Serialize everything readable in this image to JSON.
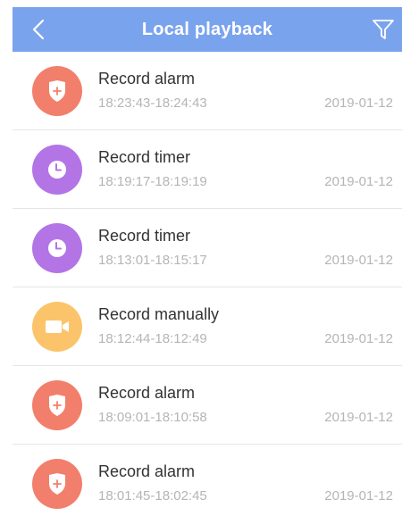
{
  "header": {
    "title": "Local playback",
    "back_icon": "chevron-left-icon",
    "filter_icon": "filter-icon",
    "background": "#7aa3ee"
  },
  "records": [
    {
      "type": "alarm",
      "title": "Record alarm",
      "time": "18:23:43-18:24:43",
      "date": "2019-01-12",
      "color": "#f27f6b",
      "icon": "shield-plus-icon"
    },
    {
      "type": "timer",
      "title": "Record timer",
      "time": "18:19:17-18:19:19",
      "date": "2019-01-12",
      "color": "#b375e5",
      "icon": "clock-icon"
    },
    {
      "type": "timer",
      "title": "Record timer",
      "time": "18:13:01-18:15:17",
      "date": "2019-01-12",
      "color": "#b375e5",
      "icon": "clock-icon"
    },
    {
      "type": "manual",
      "title": "Record manually",
      "time": "18:12:44-18:12:49",
      "date": "2019-01-12",
      "color": "#fbc46b",
      "icon": "video-camera-icon"
    },
    {
      "type": "alarm",
      "title": "Record alarm",
      "time": "18:09:01-18:10:58",
      "date": "2019-01-12",
      "color": "#f27f6b",
      "icon": "shield-plus-icon"
    },
    {
      "type": "alarm",
      "title": "Record alarm",
      "time": "18:01:45-18:02:45",
      "date": "2019-01-12",
      "color": "#f27f6b",
      "icon": "shield-plus-icon"
    }
  ]
}
